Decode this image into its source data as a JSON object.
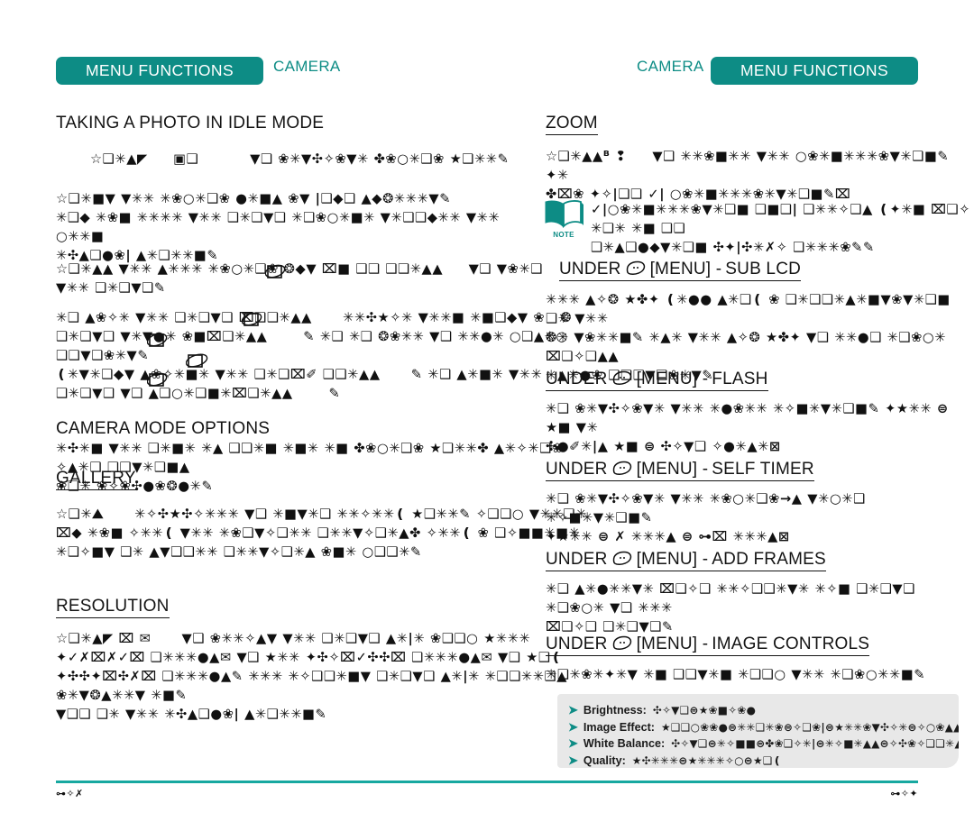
{
  "header": {
    "badge_left_label": "MENU FUNCTIONS",
    "badge_right_label": "MENU FUNCTIONS",
    "camera_left_label": "CAMERA",
    "camera_right_label": "CAMERA",
    "accent_color": "#0d8c85",
    "rule_color": "#17a8a0"
  },
  "left_column": {
    "headings": {
      "taking_photo": "TAKING A PHOTO IN IDLE MODE",
      "camera_mode_options": "CAMERA MODE OPTIONS",
      "gallery": "GALLERY",
      "resolution": "RESOLUTION"
    },
    "paragraphs": {
      "taking_photo_p1": "☆❑✳▲◤     ▣❑          ▼❑ ❀✳▼✣✧❀▼✳ ✤❀○✳❑❀ ★❑✳✳✎",
      "taking_photo_p2": "☆❑✳■▼ ▼✳✳ ✳❀○✳❑❀ ●✳■▲ ❀▼ |❑◆❑ ▲◆❂✳✳✳▼✎\n✳❑◆ ✳❀■ ✳✳✳✳ ▼✳✳ ❑✳❑▼❑ ✳❑❀○✳■✳ ▼✳❑❑◆✳✳ ▼✳✳ ○✳✳■\n✳✣▲❑●❀| ▲✳❑✳✳■✎",
      "taking_photo_p3": "☆❑✳▲▲ ▼✳✳ ▲✳✳✳ ✳❀○✳❑❀ ❂◆▼ ⌧■ ❑❑ ❑❑✳▲▲     ▼❑ ▼❀✳❑\n▼✳✳ ❑✳❑▼❑✎",
      "taking_photo_p4": "✳❑ ▲❀✧✳ ▼✳✳ ❑✳❑▼❑ ⌧❑❑✳▲▲      ✳✳✣★✧✳ ▼✳✳■ ✳■❑◆▼ ❀   ❂\n❑✳❑▼❑ ▼✳▼●✳ ❀■⌧❑✳▲▲       ✎ ✳❑ ✳❑ ❂❀✳✳ ▼❑ ✳✳●✳ ○❑▲✳○ ❑❑▼❑❀✳▼✎\n❪✳▼✳❑◆▼ ▲❀✧✳■✳ ▼✳✳ ❑✳❑⌧✐ ❑❑✳▲▲      ✎ ✳❑ ▲✳■✳ ▼✳✳\n❑✳❑▼❑ ▼❑ ▲❑○✳❑■✳⌧❑✳▲▲       ✎"
    },
    "camera_mode_options_body": "✳✣✳■ ▼✳✳ ❑✳■✳ ✳▲ ❑❑✳■ ✳■✳ ✳■ ✤❀○✳❑❀ ★❑✳✳✤ ▲✳✧✳❑❀ ✧▲✳❑ ❑❑▼✳❑■▲\n❀❑✳ ❀✧❀✣●❀❂●✳✎",
    "gallery_body": "☆❑✳⛰      ✳✧✣★✣✧✳✳✳ ▼❑ ✳■▼✳❑ ✳✳✧✳✳❪ ★❑✳✳✎ ✧❑❑○ ▼✳✳❑✳\n⌧◆ ✳❀■ ✧✳✳❪ ▼✳✳ ✳❀❑▼✧❑✳✳ ❑✳✳▼✧❑✳▲✤ ✧✳✳❪ ❀ ❑✧■■✳■✳\n✳❑✧■▼ ❑✳ ▲▼❑❑✳✳ ❑✳✳▼✧❑✳▲ ❀■✳ ○❑❑✳✎",
    "resolution_body": "☆❑✳▲◤ ⌧ ✉      ▼❑ ❀✳✳✧▲▼ ▼✳✳ ❑✳❑▼❑ ▲✳|✳ ❀❑❑○ ★✳✳✳\n✦✓✗⌧✗✓⌧ ❑✳✳✳●▲✉ ▼❑ ★✳✳ ✦✣✧⌧✓✣✣⌧ ❑✳✳✳●▲✉ ▼❑ ★❑❪\n✦✣✣✦⌧✣✗⌧ ❑✳✳✳●▲✎ ✳✳✳ ✳✧❑❑✳■▼ ❑✳❑▼❑ ▲✳|✳ ✳❑❑✳✳❑▲ ❀✳▼❂▲✳✳▼ ✳■✎\n▼❑❑ ❑✳ ▼✳✳ ✳✣▲❑●❀| ▲✳❑✳✳■✎"
  },
  "right_column": {
    "headings": {
      "zoom": "ZOOM",
      "sub_lcd": "SUB LCD",
      "flash": "FLASH",
      "self_timer": "SELF TIMER",
      "add_frames": "ADD FRAMES",
      "image_controls": "IMAGE CONTROLS"
    },
    "under_prefix": "UNDER",
    "menu_token": "[MENU] -",
    "paragraphs": {
      "zoom_body": "☆❑✳▲▲ᴮ ❢     ▼❑ ✳✳❀■✳✳ ▼✳✳ ○❀✳■✳✳✳❀▼✳❑■✎ ✦✳\n✤⌧❀ ✦✧|❑❑ ✓| ○❀✳■✳✳✳❀✳▼✳❑■✎⌧",
      "note_body": "✓|○❀✳■✳✳✳❀▼✳❑■ ❑■❑| ❑✳✳✧❑▲ ❪✦✳■ ⌧❑✧ ✳❑✳ ✳■ ❑❑\n❑✳▲❑●◆▼✳❑■ ✣✦|✣✳✗✧ ❑✳✳✳❀✎✎",
      "sub_lcd_body": "✳✳✳ ▲✧❂ ★✤✦ ❪✳●● ▲✳❑❪ ❀ ❑✳❑❑✳▲✳■▼❀▼✳❑■ ❑✳ ▼✳✳\n❂✳ ▼❀✳✳■✎ ✳▲✳ ▼✳✳ ▲✧❂ ★✤✦ ▼❑ ✳✳●❑ ✳❑❀○✳ ⌧❑✧❑▲▲\n✳▲✳●❀ ❑❑❑▼❑❀✳▼✎",
      "flash_body": "✳❑ ❀✳▼✣✧❀▼✳ ▼✳✳ ✳●❀✳✳ ✳✧■✳▼✳❑■✎ ✦★✳✳ ⊜ ★■ ▼✳\n✣●✐✳|▲ ★■ ⊜ ✣✧▼❑ ✧●✳▲✳⊠",
      "self_timer_body": "✳❑ ❀✳▼✣✧❀▼✳ ▼✳✳ ✳❀○✳❑❀→▲ ▼✳○✳❑ ✳✧■✳▼✳❑■✎\n✦★✳✳ ⊜ ✗ ✳✳✳▲ ⊜ ⊶⌧ ✳✳✳▲⊠",
      "add_frames_body": "✳❑ ▲✳●✳✳▼✳ ⌧❑✧❑ ✳✳✧❑❑✳▼✳ ✳✧■ ❑✳❑▼❑ ✳❑❀○✳ ▼❑ ✳✳✳\n⌧❑✧❑ ❑✳❑▼❑✎",
      "image_controls_body": "✳❑✳❀✳✦✳▼ ✳■ ❑❑▼✳■ ✳❑❑○ ▼✳✳ ✳❑❀○✳✳■✎"
    }
  },
  "callout": {
    "background": "#e8e8e8",
    "bullet_color": "#0d8c85",
    "items": [
      {
        "label": "Brightness:",
        "value": "✣✧▼❑⊜★❀■✧❀●"
      },
      {
        "label": "Image Effect:",
        "value": "★❑❑○❀❀●⊜✳✳❑✳❀⊜✧❑❀|⊜★✳✳❀▼✣✧✳⊜✧○❀▲▲⊜"
      },
      {
        "label": "White Balance:",
        "value": "✣✧▼❑⊜✳✧■■⊜✤❀❑✧✳|⊜✳✧■✳▲▲⊜✧✣❀✧❑❑✳▲"
      },
      {
        "label": "Quality:",
        "value": "★✣✳✳✳⊜★✳✳✳✧○⊜★❑❪"
      }
    ]
  },
  "footer": {
    "page_left": "⊶✧✗",
    "page_right": "⊶✧✦"
  },
  "icons": {
    "note": "note-book-icon",
    "menu_key": "menu-key-icon",
    "camera_key": "camera-key-icon"
  }
}
